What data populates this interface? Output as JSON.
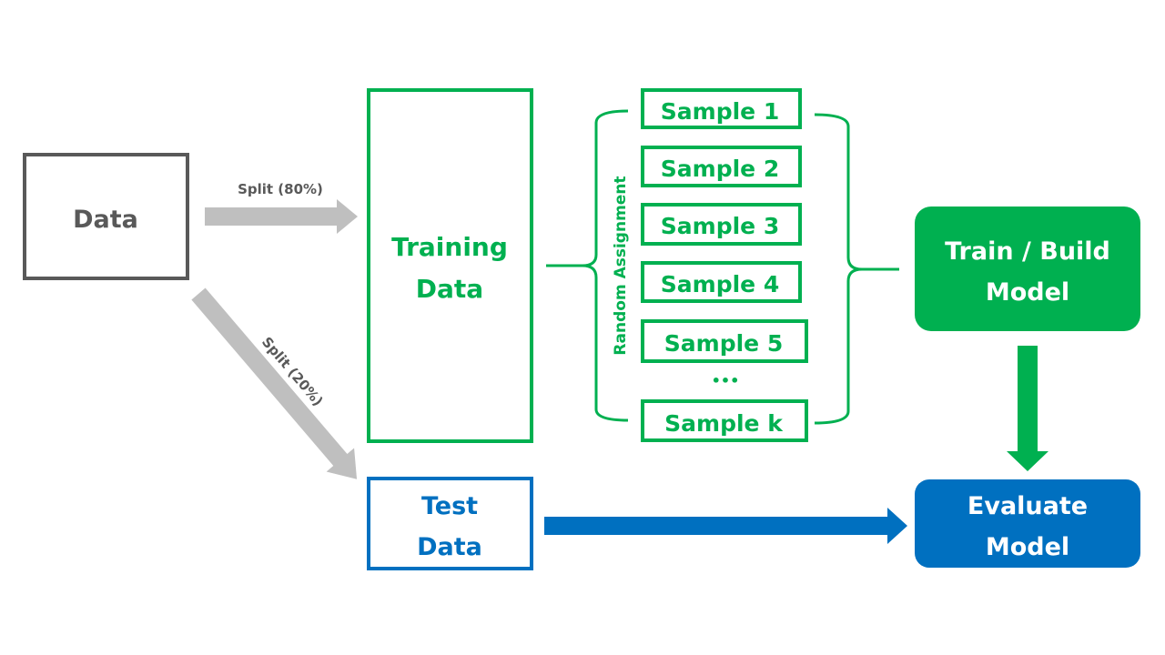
{
  "colors": {
    "gray": "#595959",
    "arrow_gray": "#bfbfbf",
    "green": "#00b050",
    "blue": "#0070c0",
    "white": "#ffffff"
  },
  "data_box": {
    "label": "Data"
  },
  "split_train": {
    "label": "Split (80%)"
  },
  "split_test": {
    "label": "Split (20%)"
  },
  "training_box": {
    "line1": "Training",
    "line2": "Data"
  },
  "random_assignment": {
    "label": "Random Assignment"
  },
  "samples": [
    {
      "label": "Sample 1"
    },
    {
      "label": "Sample 2"
    },
    {
      "label": "Sample 3"
    },
    {
      "label": "Sample 4"
    },
    {
      "label": "Sample 5"
    },
    {
      "label": "Sample k"
    }
  ],
  "ellipsis": "•••",
  "train_box": {
    "line1": "Train / Build",
    "line2": "Model"
  },
  "test_box": {
    "line1": "Test",
    "line2": "Data"
  },
  "evaluate_box": {
    "line1": "Evaluate",
    "line2": "Model"
  }
}
